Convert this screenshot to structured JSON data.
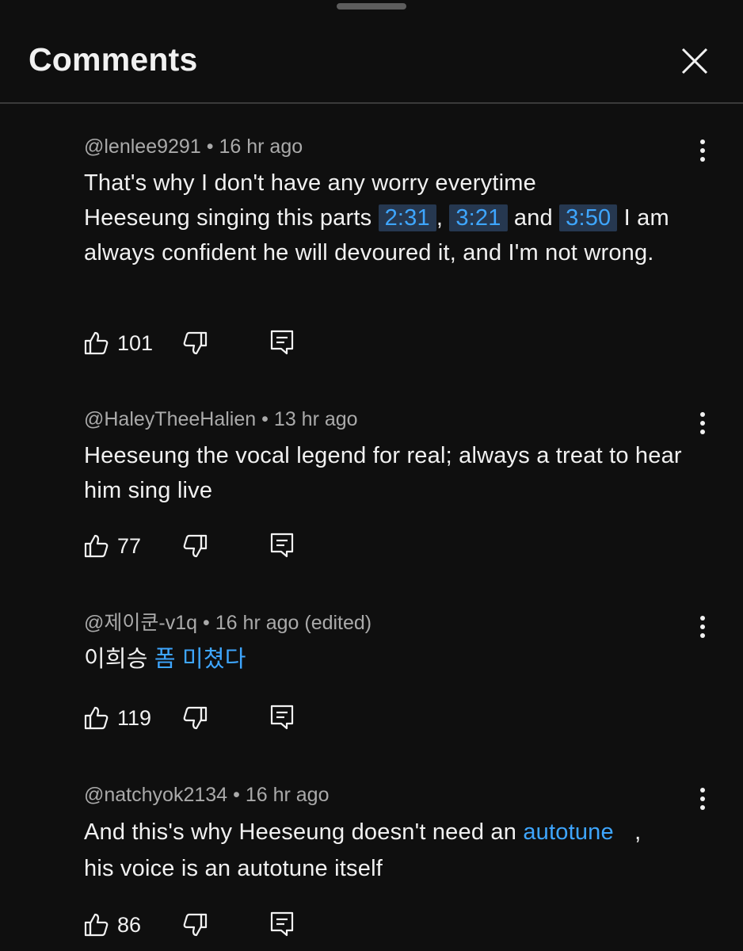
{
  "header": {
    "title": "Comments"
  },
  "comments": [
    {
      "author": "@lenlee9291",
      "time": "16 hr ago",
      "text": {
        "p1": "That's why I don't have any worry everytime",
        "p2": "Heeseung singing this parts",
        "t1": "2:31",
        "sep1": ",",
        "t2": "3:21",
        "sep2": "and",
        "t3": "3:50",
        "p3": "I am always confident he will devoured it, and I'm not wrong."
      },
      "likes": "101"
    },
    {
      "author": "@HaleyTheeHalien",
      "time": "13 hr ago",
      "text": "Heeseung the vocal legend for real; always a treat to hear him sing live",
      "likes": "77"
    },
    {
      "author": "@제이쿤-v1q",
      "time": "16 hr ago (edited)",
      "text": {
        "plain": "이희승",
        "link": "폼 미쳤다"
      },
      "likes": "119"
    },
    {
      "author": "@natchyok2134",
      "time": "16 hr ago",
      "text": {
        "p1": "And this's why Heeseung doesn't need an",
        "link": "autotune",
        "p2": ",",
        "p3": "his voice is an autotune itself"
      },
      "likes": "86"
    }
  ],
  "colors": {
    "background": "#0f0f0f",
    "link": "#3ea6ff",
    "timestamp_bg": "#263850",
    "meta": "#aaaaaa"
  }
}
